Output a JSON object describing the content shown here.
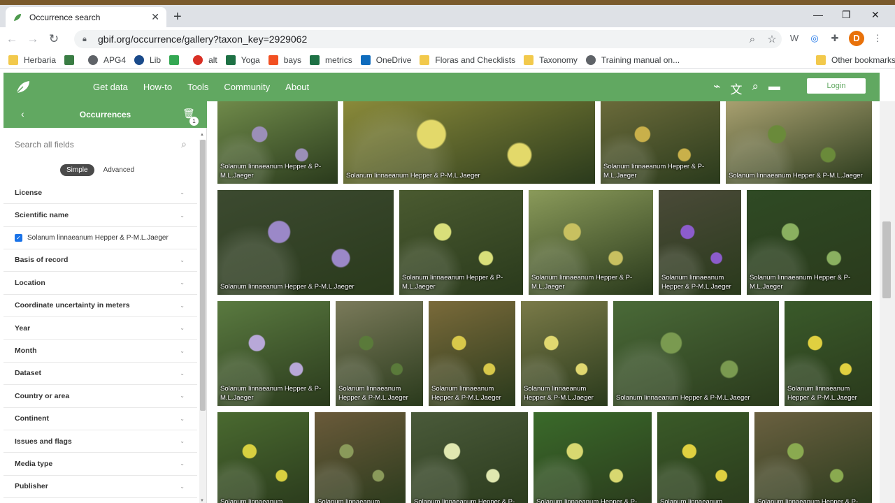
{
  "browser": {
    "tab_title": "Occurrence search",
    "tab_close": "✕",
    "new_tab": "+",
    "url": "gbif.org/occurrence/gallery?taxon_key=2929062",
    "avatar_letter": "D"
  },
  "bookmarks": [
    {
      "label": "Herbaria",
      "icon": "folder-icon",
      "color": "#f2c94c"
    },
    {
      "label": "",
      "icon": "grid-icon",
      "color": "#3a7d44"
    },
    {
      "label": "APG4",
      "icon": "globe-icon",
      "color": "#5f6368"
    },
    {
      "label": "Lib",
      "icon": "globe-icon",
      "color": "#1a4a8a"
    },
    {
      "label": "",
      "icon": "play-icon",
      "color": "#34a853"
    },
    {
      "label": "alt",
      "icon": "circle-icon",
      "color": "#d93025"
    },
    {
      "label": "Yoga",
      "icon": "excel-icon",
      "color": "#1e7145"
    },
    {
      "label": "bays",
      "icon": "windows-icon",
      "color": "#f25022"
    },
    {
      "label": "metrics",
      "icon": "excel-icon",
      "color": "#1e7145"
    },
    {
      "label": "OneDrive",
      "icon": "cloud-icon",
      "color": "#0f6cbd"
    },
    {
      "label": "Floras and Checklists",
      "icon": "folder-icon",
      "color": "#f2c94c"
    },
    {
      "label": "Taxonomy",
      "icon": "folder-icon",
      "color": "#f2c94c"
    },
    {
      "label": "Training manual on...",
      "icon": "globe-icon",
      "color": "#5f6368"
    }
  ],
  "other_bookmarks": "Other bookmarks",
  "gbif_nav": {
    "items": [
      "Get data",
      "How-to",
      "Tools",
      "Community",
      "About"
    ],
    "login": "Login"
  },
  "sidebar": {
    "title": "Occurrences",
    "badge": "1",
    "search_placeholder": "Search all fields",
    "mode_simple": "Simple",
    "mode_advanced": "Advanced",
    "filters": [
      "License",
      "Scientific name"
    ],
    "checked_value": "Solanum linnaeanum Hepper & P-M.L.Jaeger",
    "filters2": [
      "Basis of record",
      "Location",
      "Coordinate uncertainty in meters",
      "Year",
      "Month",
      "Dataset",
      "Country or area",
      "Continent",
      "Issues and flags",
      "Media type",
      "Publisher"
    ]
  },
  "gallery": {
    "caption_full": "Solanum linnaeanum Hepper & P-M.L.Jaeger",
    "caption_wrap1": "Solanum linnaeanum Hepper & P-",
    "caption_wrap1b": "M.L.Jaeger",
    "caption_wrap2": "Solanum linnaeanum",
    "caption_wrap2b": "Hepper & P-M.L.Jaeger",
    "rows": [
      [
        {
          "w": 172,
          "caption": [
            "Solanum linnaeanum Hepper & P-",
            "M.L.Jaeger"
          ],
          "bg": "#6f8a4a",
          "accent": "#9b8fb8"
        },
        {
          "w": 360,
          "caption": [
            "Solanum linnaeanum Hepper & P-M.L.Jaeger"
          ],
          "bg": "#8a8a3a",
          "accent": "#e3d96a"
        },
        {
          "w": 171,
          "caption": [
            "Solanum linnaeanum Hepper & P-",
            "M.L.Jaeger"
          ],
          "bg": "#6a6a3a",
          "accent": "#c9b04a"
        },
        {
          "w": 209,
          "caption": [
            "Solanum linnaeanum Hepper & P-M.L.Jaeger"
          ],
          "bg": "#a8a070",
          "accent": "#6a8a3a"
        }
      ],
      [
        {
          "w": 252,
          "caption": [
            "Solanum linnaeanum Hepper & P-M.L.Jaeger"
          ],
          "bg": "#3c4a30",
          "accent": "#9b88c8"
        },
        {
          "w": 177,
          "caption": [
            "Solanum linnaeanum Hepper & P-",
            "M.L.Jaeger"
          ],
          "bg": "#4a5a30",
          "accent": "#d9df7a"
        },
        {
          "w": 178,
          "caption": [
            "Solanum linnaeanum Hepper & P-",
            "M.L.Jaeger"
          ],
          "bg": "#8a9a5a",
          "accent": "#c8c060"
        },
        {
          "w": 118,
          "caption": [
            "Solanum linnaeanum",
            "Hepper & P-M.L.Jaeger"
          ],
          "bg": "#4a4a38",
          "accent": "#8c5ccc"
        },
        {
          "w": 178,
          "caption": [
            "Solanum linnaeanum Hepper & P-",
            "M.L.Jaeger"
          ],
          "bg": "#2f4a24",
          "accent": "#8ab060"
        }
      ],
      [
        {
          "w": 161,
          "caption": [
            "Solanum linnaeanum Hepper & P-",
            "M.L.Jaeger"
          ],
          "bg": "#5a7a40",
          "accent": "#b8a8d8"
        },
        {
          "w": 125,
          "caption": [
            "Solanum linnaeanum",
            "Hepper & P-M.L.Jaeger"
          ],
          "bg": "#7a7a5a",
          "accent": "#5a7a3a"
        },
        {
          "w": 124,
          "caption": [
            "Solanum linnaeanum",
            "Hepper & P-M.L.Jaeger"
          ],
          "bg": "#7a6a3a",
          "accent": "#d8c84a"
        },
        {
          "w": 124,
          "caption": [
            "Solanum linnaeanum",
            "Hepper & P-M.L.Jaeger"
          ],
          "bg": "#7a7a48",
          "accent": "#e0d870"
        },
        {
          "w": 237,
          "caption": [
            "Solanum linnaeanum Hepper & P-M.L.Jaeger"
          ],
          "bg": "#4a6a38",
          "accent": "#7a9a50"
        },
        {
          "w": 125,
          "caption": [
            "Solanum linnaeanum",
            "Hepper & P-M.L.Jaeger"
          ],
          "bg": "#3a5a2a",
          "accent": "#e0d040"
        }
      ],
      [
        {
          "w": 131,
          "caption": [
            "Solanum linnaeanum"
          ],
          "bg": "#4a6a30",
          "accent": "#d8d040"
        },
        {
          "w": 130,
          "caption": [
            "Solanum linnaeanum"
          ],
          "bg": "#6a5a3a",
          "accent": "#8a9a5a"
        },
        {
          "w": 167,
          "caption": [
            "Solanum linnaeanum Hepper & P-"
          ],
          "bg": "#4a5a3a",
          "accent": "#e0e8b0"
        },
        {
          "w": 169,
          "caption": [
            "Solanum linnaeanum Hepper & P-"
          ],
          "bg": "#3a6a2a",
          "accent": "#d8d870"
        },
        {
          "w": 131,
          "caption": [
            "Solanum linnaeanum"
          ],
          "bg": "#3a5a28",
          "accent": "#e0d040"
        },
        {
          "w": 168,
          "caption": [
            "Solanum linnaeanum Hepper & P-"
          ],
          "bg": "#6a6040",
          "accent": "#8aaa50"
        }
      ]
    ]
  }
}
